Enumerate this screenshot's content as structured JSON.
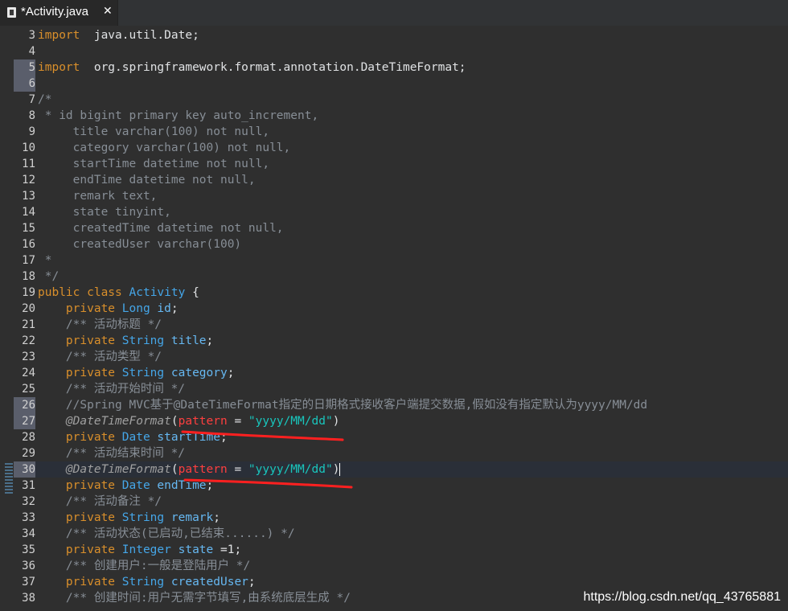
{
  "tab": {
    "title": "*Activity.java",
    "icon": "java-file-icon",
    "close": "✕"
  },
  "colors": {
    "keyword": "#d98f2b",
    "type": "#45a6e8",
    "string": "#19c6bd",
    "annotation": "#a0a0a0",
    "comment": "#878e96",
    "highlight_ink": "#ff2020"
  },
  "lines": [
    {
      "n": "3",
      "segs": [
        [
          "kw",
          "import"
        ],
        [
          "",
          "  java.util.Date;"
        ]
      ]
    },
    {
      "n": "4",
      "segs": []
    },
    {
      "n": "5",
      "segs": [
        [
          "kw",
          "import"
        ],
        [
          "",
          "  org.springframework.format.annotation.DateTimeFormat;"
        ]
      ]
    },
    {
      "n": "6",
      "segs": []
    },
    {
      "n": "7",
      "segs": [
        [
          "cm",
          "/*"
        ]
      ]
    },
    {
      "n": "8",
      "segs": [
        [
          "cm",
          " * id bigint primary key auto_increment,"
        ]
      ]
    },
    {
      "n": "9",
      "segs": [
        [
          "cm",
          "     title varchar(100) not null,"
        ]
      ]
    },
    {
      "n": "10",
      "segs": [
        [
          "cm",
          "     category varchar(100) not null,"
        ]
      ]
    },
    {
      "n": "11",
      "segs": [
        [
          "cm",
          "     startTime datetime not null,"
        ]
      ]
    },
    {
      "n": "12",
      "segs": [
        [
          "cm",
          "     endTime datetime not null,"
        ]
      ]
    },
    {
      "n": "13",
      "segs": [
        [
          "cm",
          "     remark text,"
        ]
      ]
    },
    {
      "n": "14",
      "segs": [
        [
          "cm",
          "     state tinyint,"
        ]
      ]
    },
    {
      "n": "15",
      "segs": [
        [
          "cm",
          "     createdTime datetime not null,"
        ]
      ]
    },
    {
      "n": "16",
      "segs": [
        [
          "cm",
          "     createdUser varchar(100)"
        ]
      ]
    },
    {
      "n": "17",
      "segs": [
        [
          "cm",
          " *"
        ]
      ]
    },
    {
      "n": "18",
      "segs": [
        [
          "cm",
          " */"
        ]
      ]
    },
    {
      "n": "19",
      "segs": [
        [
          "kw",
          "public class "
        ],
        [
          "ty",
          "Activity"
        ],
        [
          "",
          " {"
        ]
      ]
    },
    {
      "n": "20",
      "segs": [
        [
          "",
          "    "
        ],
        [
          "kw",
          "private "
        ],
        [
          "ty",
          "Long "
        ],
        [
          "fd",
          "id"
        ],
        [
          "",
          ";"
        ]
      ]
    },
    {
      "n": "21",
      "segs": [
        [
          "jc",
          "    /** 活动标题 */"
        ]
      ]
    },
    {
      "n": "22",
      "segs": [
        [
          "",
          "    "
        ],
        [
          "kw",
          "private "
        ],
        [
          "ty",
          "String "
        ],
        [
          "fd",
          "title"
        ],
        [
          "",
          ";"
        ]
      ]
    },
    {
      "n": "23",
      "segs": [
        [
          "jc",
          "    /** 活动类型 */"
        ]
      ]
    },
    {
      "n": "24",
      "segs": [
        [
          "",
          "    "
        ],
        [
          "kw",
          "private "
        ],
        [
          "ty",
          "String "
        ],
        [
          "fd",
          "category"
        ],
        [
          "",
          ";"
        ]
      ]
    },
    {
      "n": "25",
      "segs": [
        [
          "jc",
          "    /** 活动开始时间 */"
        ]
      ]
    },
    {
      "n": "26",
      "segs": [
        [
          "cm",
          "    //Spring MVC基于@DateTimeFormat指定的日期格式接收客户端提交数据,假如没有指定默认为yyyy/MM/dd"
        ]
      ]
    },
    {
      "n": "27",
      "segs": [
        [
          "",
          "    "
        ],
        [
          "an",
          "@DateTimeFormat"
        ],
        [
          "",
          "("
        ],
        [
          "pa",
          "pattern"
        ],
        [
          "",
          " = "
        ],
        [
          "st",
          "\"yyyy/MM/dd\""
        ],
        [
          "",
          ")"
        ]
      ]
    },
    {
      "n": "28",
      "segs": [
        [
          "",
          "    "
        ],
        [
          "kw",
          "private "
        ],
        [
          "ty",
          "Date "
        ],
        [
          "fd",
          "startTime"
        ],
        [
          "",
          ";"
        ]
      ]
    },
    {
      "n": "29",
      "segs": [
        [
          "jc",
          "    /** 活动结束时间 */"
        ]
      ]
    },
    {
      "n": "30",
      "segs": [
        [
          "",
          "    "
        ],
        [
          "an",
          "@DateTimeFormat"
        ],
        [
          "",
          "("
        ],
        [
          "pa",
          "pattern"
        ],
        [
          "",
          " = "
        ],
        [
          "st",
          "\"yyyy/MM/dd\""
        ],
        [
          "",
          ")"
        ]
      ]
    },
    {
      "n": "31",
      "segs": [
        [
          "",
          "    "
        ],
        [
          "kw",
          "private "
        ],
        [
          "ty",
          "Date "
        ],
        [
          "fd",
          "endTime"
        ],
        [
          "",
          ";"
        ]
      ]
    },
    {
      "n": "32",
      "segs": [
        [
          "jc",
          "    /** 活动备注 */"
        ]
      ]
    },
    {
      "n": "33",
      "segs": [
        [
          "",
          "    "
        ],
        [
          "kw",
          "private "
        ],
        [
          "ty",
          "String "
        ],
        [
          "fd",
          "remark"
        ],
        [
          "",
          ";"
        ]
      ]
    },
    {
      "n": "34",
      "segs": [
        [
          "jc",
          "    /** 活动状态(已启动,已结束......) */"
        ]
      ]
    },
    {
      "n": "35",
      "segs": [
        [
          "",
          "    "
        ],
        [
          "kw",
          "private "
        ],
        [
          "ty",
          "Integer "
        ],
        [
          "fd",
          "state "
        ],
        [
          "",
          "=1;"
        ]
      ]
    },
    {
      "n": "36",
      "segs": [
        [
          "jc",
          "    /** 创建用户:一般是登陆用户 */"
        ]
      ]
    },
    {
      "n": "37",
      "segs": [
        [
          "",
          "    "
        ],
        [
          "kw",
          "private "
        ],
        [
          "ty",
          "String "
        ],
        [
          "fd",
          "createdUser"
        ],
        [
          "",
          ";"
        ]
      ]
    },
    {
      "n": "38",
      "segs": [
        [
          "jc",
          "    /** 创建时间:用户无需字节填写,由系统底层生成 */"
        ]
      ]
    }
  ],
  "gutter_marked_lines": [
    "5",
    "6",
    "26",
    "27",
    "30"
  ],
  "changed_lines": [
    "30",
    "31"
  ],
  "current_line": "30",
  "watermark": "https://blog.csdn.net/qq_43765881"
}
